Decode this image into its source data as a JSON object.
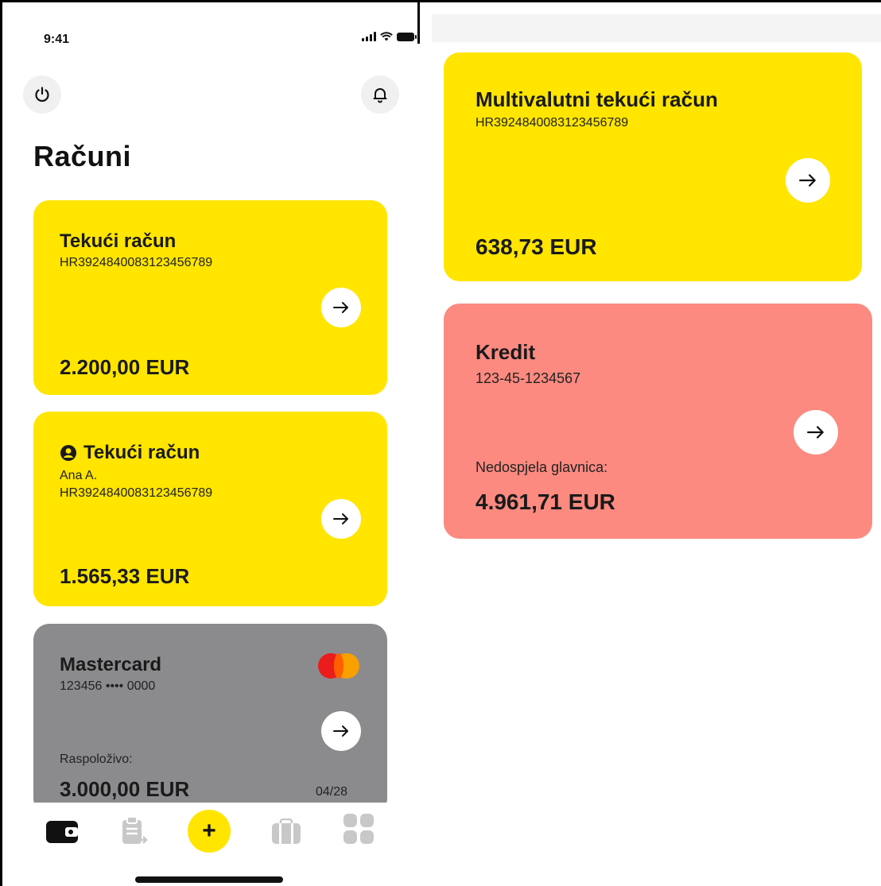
{
  "status": {
    "time": "9:41"
  },
  "page": {
    "title": "Računi"
  },
  "accounts": [
    {
      "title": "Tekući račun",
      "iban": "HR3924840083123456789",
      "amount": "2.200,00 EUR"
    },
    {
      "title": "Tekući račun",
      "holder": "Ana A.",
      "iban": "HR3924840083123456789",
      "amount": "1.565,33 EUR"
    }
  ],
  "card": {
    "title": "Mastercard",
    "number": "123456 •••• 0000",
    "available_label": "Raspoloživo:",
    "amount": "3.000,00 EUR",
    "expiry": "04/28"
  },
  "multi": {
    "title": "Multivalutni tekući račun",
    "iban": "HR3924840083123456789",
    "amount": "638,73 EUR"
  },
  "loan": {
    "title": "Kredit",
    "number": "123-45-1234567",
    "principal_label": "Nedospjela glavnica:",
    "amount": "4.961,71 EUR"
  },
  "tabbar": {
    "fab_label": "+"
  },
  "colors": {
    "yellow": "#ffe500",
    "grey": "#8b8b8e",
    "salmon": "#fc8a80"
  },
  "icons": [
    "power-icon",
    "bell-icon",
    "arrow-right-icon",
    "user-icon",
    "mastercard-logo",
    "wallet-icon",
    "clipboard-icon",
    "plus-icon",
    "briefcase-icon",
    "grid-icon"
  ]
}
